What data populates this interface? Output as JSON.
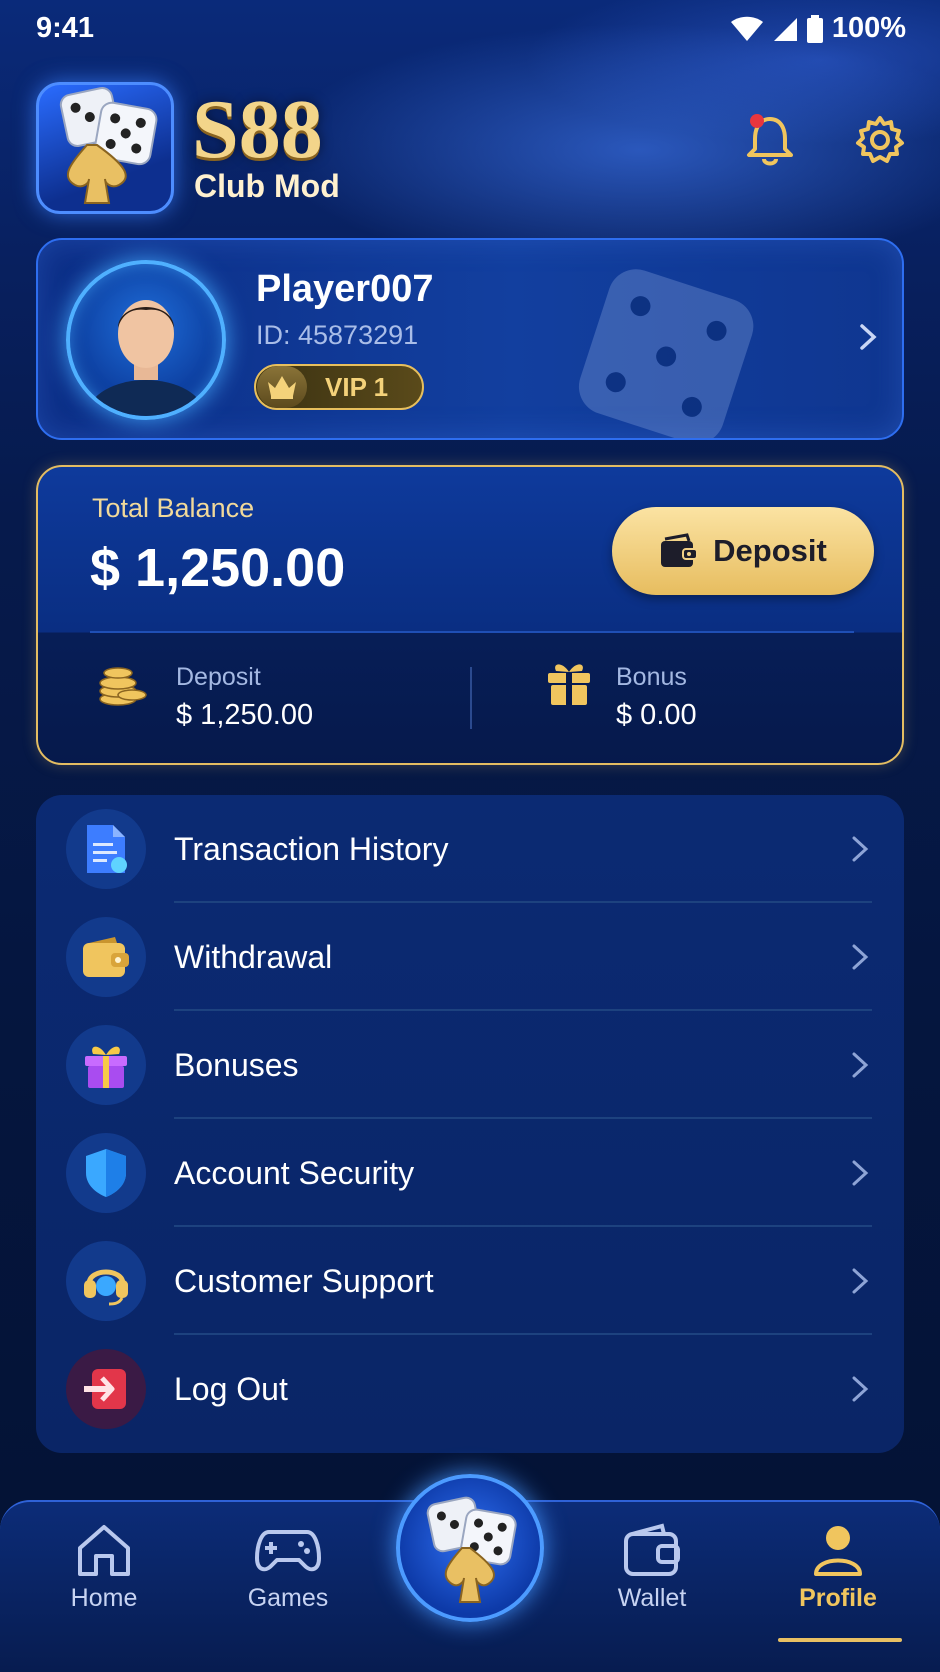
{
  "status_bar": {
    "time": "9:41",
    "battery": "100%"
  },
  "header": {
    "brand": "S88",
    "subtitle": "Club Mod"
  },
  "profile": {
    "name": "Player007",
    "id_text": "ID: 45873291",
    "vip": "VIP 1"
  },
  "balance": {
    "label": "Total Balance",
    "amount": "$ 1,250.00",
    "deposit_button": "Deposit",
    "deposit_label": "Deposit",
    "deposit_value": "$ 1,250.00",
    "bonus_label": "Bonus",
    "bonus_value": "$ 0.00"
  },
  "menu": [
    {
      "label": "Transaction History",
      "icon": "document-icon"
    },
    {
      "label": "Withdrawal",
      "icon": "wallet-icon"
    },
    {
      "label": "Bonuses",
      "icon": "gift-icon"
    },
    {
      "label": "Account Security",
      "icon": "shield-icon"
    },
    {
      "label": "Customer Support",
      "icon": "headset-icon"
    },
    {
      "label": "Log Out",
      "icon": "logout-icon"
    }
  ],
  "nav": [
    {
      "label": "Home",
      "icon": "home-icon"
    },
    {
      "label": "Games",
      "icon": "gamepad-icon"
    },
    {
      "label": "Wallet",
      "icon": "wallet-icon"
    },
    {
      "label": "Profile",
      "icon": "user-icon",
      "active": true
    }
  ],
  "colors": {
    "accent_gold": "#e9c063",
    "bg_dark": "#05163f",
    "primary_blue": "#2f6ff2"
  }
}
